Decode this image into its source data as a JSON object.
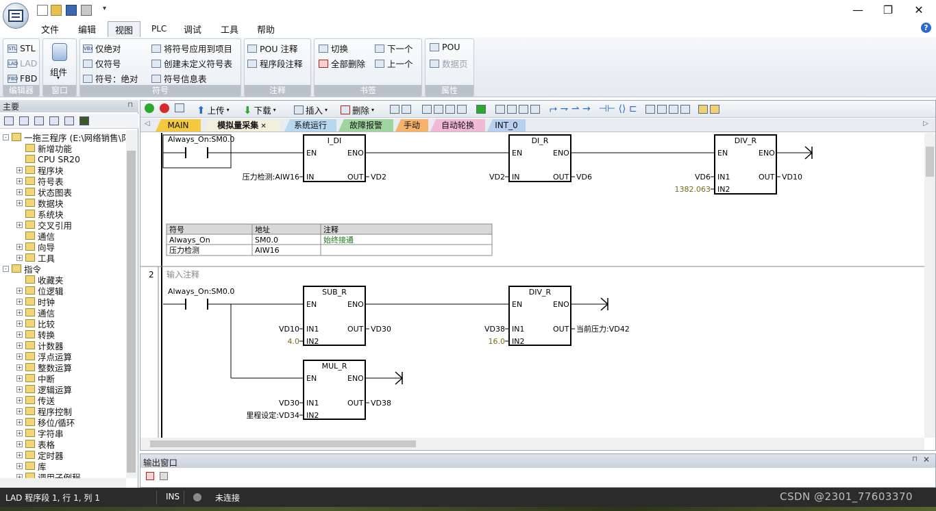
{
  "window": {
    "minimize": "—",
    "maximize": "❐",
    "close": "✕"
  },
  "menu": [
    "文件",
    "编辑",
    "视图",
    "PLC",
    "调试",
    "工具",
    "帮助"
  ],
  "ribbon": {
    "groups": {
      "editor": "编辑器",
      "window": "窗口",
      "symbol": "符号",
      "comment": "注释",
      "bookmark": "书签",
      "properties": "属性"
    },
    "editor_items": [
      "STL",
      "LAD",
      "FBD"
    ],
    "component": "组件",
    "symbol_left": [
      "仅绝对",
      "仅符号",
      "符号：绝对"
    ],
    "symbol_right": [
      "将符号应用到项目",
      "创建未定义符号表",
      "符号信息表"
    ],
    "comment_items": [
      "POU 注释",
      "程序段注释"
    ],
    "bookmark_left": [
      "切换",
      "全部删除"
    ],
    "bookmark_right": [
      "下一个",
      "上一个"
    ],
    "prop_items": [
      "POU",
      "数据页"
    ]
  },
  "left_panel": {
    "title": "主要",
    "tree": [
      {
        "label": "一拖三程序 (E:\\网络销售\\阝",
        "indent": 0,
        "expand": "-"
      },
      {
        "label": "新增功能",
        "indent": 1,
        "expand": ""
      },
      {
        "label": "CPU SR20",
        "indent": 1,
        "expand": ""
      },
      {
        "label": "程序块",
        "indent": 1,
        "expand": "+"
      },
      {
        "label": "符号表",
        "indent": 1,
        "expand": "+"
      },
      {
        "label": "状态图表",
        "indent": 1,
        "expand": "+"
      },
      {
        "label": "数据块",
        "indent": 1,
        "expand": "+"
      },
      {
        "label": "系统块",
        "indent": 1,
        "expand": ""
      },
      {
        "label": "交叉引用",
        "indent": 1,
        "expand": "+"
      },
      {
        "label": "通信",
        "indent": 1,
        "expand": ""
      },
      {
        "label": "向导",
        "indent": 1,
        "expand": "+"
      },
      {
        "label": "工具",
        "indent": 1,
        "expand": "+"
      },
      {
        "label": "指令",
        "indent": 0,
        "expand": "-"
      },
      {
        "label": "收藏夹",
        "indent": 1,
        "expand": ""
      },
      {
        "label": "位逻辑",
        "indent": 1,
        "expand": "+"
      },
      {
        "label": "时钟",
        "indent": 1,
        "expand": "+"
      },
      {
        "label": "通信",
        "indent": 1,
        "expand": "+"
      },
      {
        "label": "比较",
        "indent": 1,
        "expand": "+"
      },
      {
        "label": "转换",
        "indent": 1,
        "expand": "+"
      },
      {
        "label": "计数器",
        "indent": 1,
        "expand": "+"
      },
      {
        "label": "浮点运算",
        "indent": 1,
        "expand": "+"
      },
      {
        "label": "整数运算",
        "indent": 1,
        "expand": "+"
      },
      {
        "label": "中断",
        "indent": 1,
        "expand": "+"
      },
      {
        "label": "逻辑运算",
        "indent": 1,
        "expand": "+"
      },
      {
        "label": "传送",
        "indent": 1,
        "expand": "+"
      },
      {
        "label": "程序控制",
        "indent": 1,
        "expand": "+"
      },
      {
        "label": "移位/循环",
        "indent": 1,
        "expand": "+"
      },
      {
        "label": "字符串",
        "indent": 1,
        "expand": "+"
      },
      {
        "label": "表格",
        "indent": 1,
        "expand": "+"
      },
      {
        "label": "定时器",
        "indent": 1,
        "expand": "+"
      },
      {
        "label": "库",
        "indent": 1,
        "expand": "+"
      },
      {
        "label": "调用子例程",
        "indent": 1,
        "expand": "+"
      }
    ]
  },
  "toolbar": {
    "upload": "上传",
    "download": "下载",
    "insert": "插入",
    "delete": "删除"
  },
  "tabs": [
    {
      "label": "MAIN",
      "color": "#f5c842",
      "active": false
    },
    {
      "label": "模拟量采集",
      "color": "#f0f0dc",
      "active": true
    },
    {
      "label": "系统运行",
      "color": "#b8d8f0",
      "active": false
    },
    {
      "label": "故障报警",
      "color": "#9ed49e",
      "active": false
    },
    {
      "label": "手动",
      "color": "#f5b26a",
      "active": false
    },
    {
      "label": "自动轮换",
      "color": "#f2b8d8",
      "active": false
    },
    {
      "label": "INT_0",
      "color": "#b8d0f0",
      "active": false
    }
  ],
  "ladder": {
    "net1": {
      "contact": "Always_On:SM0.0",
      "boxes": [
        {
          "name": "I_DI",
          "en": "EN",
          "eno": "ENO",
          "in_label": "IN",
          "in": "压力检测:AIW16",
          "out_label": "OUT",
          "out": "VD2"
        },
        {
          "name": "DI_R",
          "en": "EN",
          "eno": "ENO",
          "in_label": "IN",
          "in": "VD2",
          "out_label": "OUT",
          "out": "VD6"
        },
        {
          "name": "DIV_R",
          "en": "EN",
          "eno": "ENO",
          "in1_label": "IN1",
          "in1": "VD6",
          "in2_label": "IN2",
          "in2": "1382.063",
          "out_label": "OUT",
          "out": "VD10"
        }
      ],
      "symtable": {
        "headers": [
          "符号",
          "地址",
          "注释"
        ],
        "rows": [
          [
            "Always_On",
            "SM0.0",
            "始终接通"
          ],
          [
            "压力检测",
            "AIW16",
            ""
          ]
        ]
      }
    },
    "net2": {
      "number": "2",
      "comment": "输入注释",
      "contact": "Always_On:SM0.0",
      "boxes": [
        {
          "name": "SUB_R",
          "en": "EN",
          "eno": "ENO",
          "in1_label": "IN1",
          "in1": "VD10",
          "in2_label": "IN2",
          "in2": "4.0",
          "out_label": "OUT",
          "out": "VD30"
        },
        {
          "name": "DIV_R",
          "en": "EN",
          "eno": "ENO",
          "in1_label": "IN1",
          "in1": "VD38",
          "in2_label": "IN2",
          "in2": "16.0",
          "out_label": "OUT",
          "out": "当前压力:VD42"
        },
        {
          "name": "MUL_R",
          "en": "EN",
          "eno": "ENO",
          "in1_label": "IN1",
          "in1": "VD30",
          "in2_label": "IN2",
          "in2": "里程设定:VD34",
          "out_label": "OUT",
          "out": "VD38"
        }
      ]
    }
  },
  "output_window": {
    "title": "输出窗口"
  },
  "status": {
    "position": "LAD 程序段 1, 行 1, 列 1",
    "mode": "INS",
    "connection": "未连接",
    "watermark": "CSDN @2301_77603370"
  }
}
